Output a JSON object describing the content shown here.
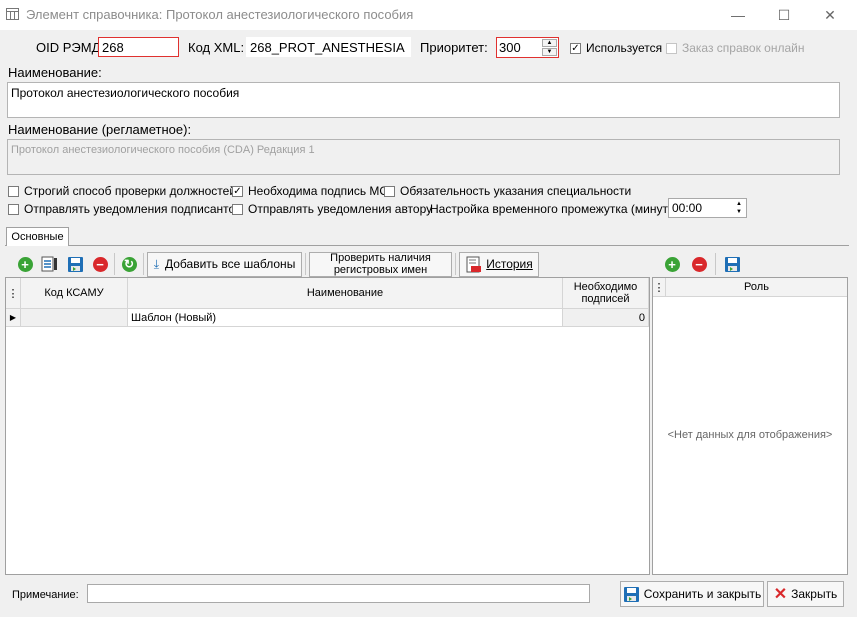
{
  "window": {
    "title": "Элемент справочника: Протокол анестезиологического пособия",
    "minimize_icon": "—",
    "maximize_icon": "☐",
    "close_icon": "✕"
  },
  "fields": {
    "oid_label": "OID РЭМД:",
    "oid_value": "268",
    "xml_label": "Код XML:",
    "xml_value": "268_PROT_ANESTHESIA",
    "priority_label": "Приоритет:",
    "priority_value": "300",
    "used_label": "Используется",
    "used_checked": true,
    "online_label": "Заказ справок онлайн",
    "online_checked": false,
    "name_label": "Наименование:",
    "name_value": "Протокол анестезиологического пособия",
    "reg_name_label": "Наименование (регламетное):",
    "reg_name_value": "Протокол анестезиологического пособия (CDA) Редакция 1"
  },
  "options": {
    "strict_check": {
      "label": "Строгий способ проверки должностей",
      "checked": false
    },
    "mo_signature": {
      "label": "Необходима подпись МО",
      "checked": true
    },
    "specialty_required": {
      "label": "Обязательность указания специальности",
      "checked": false
    },
    "notify_signers": {
      "label": "Отправлять уведомления подписантов",
      "checked": false
    },
    "notify_author": {
      "label": "Отправлять уведомления автору",
      "checked": false
    },
    "time_interval_label": "Настройка временного промежутка (минуты):",
    "time_interval_value": "00:00"
  },
  "tabs": [
    "Основные"
  ],
  "toolbar": {
    "add_all_templates": "Добавить все шаблоны",
    "check_names_line1": "Проверить наличия",
    "check_names_line2": "регистровых имен",
    "history": "История"
  },
  "main_grid": {
    "columns": [
      "Код КСАМУ",
      "Наименование",
      "Необходимо подписей"
    ],
    "rows": [
      {
        "code": "",
        "name": "Шаблон (Новый)",
        "signatures": "0"
      }
    ]
  },
  "role_grid": {
    "columns": [
      "Роль"
    ],
    "empty_text": "<Нет данных для отображения>"
  },
  "footer": {
    "note_label": "Примечание:",
    "note_value": "",
    "save_close": "Сохранить и закрыть",
    "close": "Закрыть"
  },
  "colors": {
    "required_border": "#e0312f",
    "add_green": "#3aa336",
    "remove_red": "#d9282b",
    "save_blue": "#1f6fb6"
  }
}
